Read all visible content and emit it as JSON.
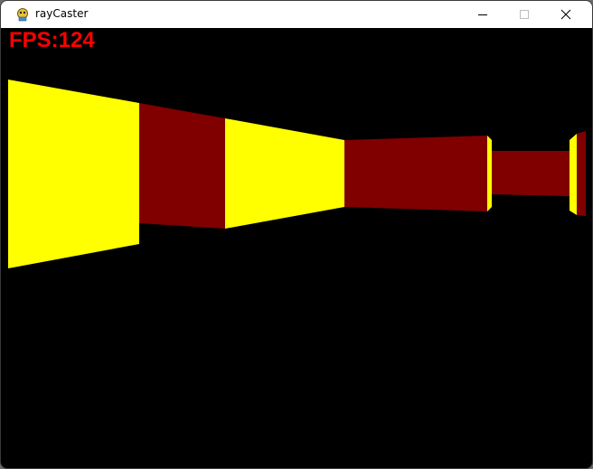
{
  "window": {
    "title": "rayCaster",
    "icon": "pygame-snake-icon"
  },
  "controls": {
    "minimize_icon": "minimize-icon",
    "maximize_icon": "maximize-icon",
    "close_icon": "close-icon"
  },
  "hud": {
    "fps_text": "FPS:124"
  },
  "colors": {
    "wall_light": "#ffff00",
    "wall_dark": "#800000",
    "background": "#000000",
    "fps_text": "#ff0000"
  }
}
